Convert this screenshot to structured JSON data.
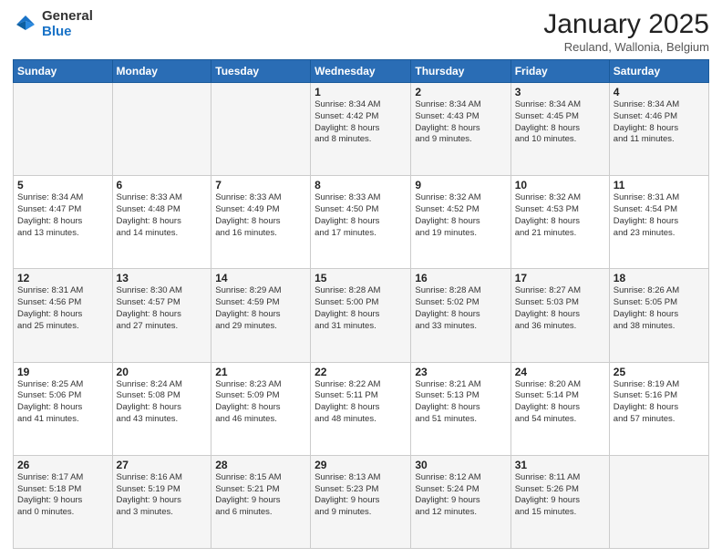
{
  "logo": {
    "general": "General",
    "blue": "Blue"
  },
  "title": "January 2025",
  "subtitle": "Reuland, Wallonia, Belgium",
  "weekdays": [
    "Sunday",
    "Monday",
    "Tuesday",
    "Wednesday",
    "Thursday",
    "Friday",
    "Saturday"
  ],
  "weeks": [
    [
      {
        "day": "",
        "info": ""
      },
      {
        "day": "",
        "info": ""
      },
      {
        "day": "",
        "info": ""
      },
      {
        "day": "1",
        "info": "Sunrise: 8:34 AM\nSunset: 4:42 PM\nDaylight: 8 hours\nand 8 minutes."
      },
      {
        "day": "2",
        "info": "Sunrise: 8:34 AM\nSunset: 4:43 PM\nDaylight: 8 hours\nand 9 minutes."
      },
      {
        "day": "3",
        "info": "Sunrise: 8:34 AM\nSunset: 4:45 PM\nDaylight: 8 hours\nand 10 minutes."
      },
      {
        "day": "4",
        "info": "Sunrise: 8:34 AM\nSunset: 4:46 PM\nDaylight: 8 hours\nand 11 minutes."
      }
    ],
    [
      {
        "day": "5",
        "info": "Sunrise: 8:34 AM\nSunset: 4:47 PM\nDaylight: 8 hours\nand 13 minutes."
      },
      {
        "day": "6",
        "info": "Sunrise: 8:33 AM\nSunset: 4:48 PM\nDaylight: 8 hours\nand 14 minutes."
      },
      {
        "day": "7",
        "info": "Sunrise: 8:33 AM\nSunset: 4:49 PM\nDaylight: 8 hours\nand 16 minutes."
      },
      {
        "day": "8",
        "info": "Sunrise: 8:33 AM\nSunset: 4:50 PM\nDaylight: 8 hours\nand 17 minutes."
      },
      {
        "day": "9",
        "info": "Sunrise: 8:32 AM\nSunset: 4:52 PM\nDaylight: 8 hours\nand 19 minutes."
      },
      {
        "day": "10",
        "info": "Sunrise: 8:32 AM\nSunset: 4:53 PM\nDaylight: 8 hours\nand 21 minutes."
      },
      {
        "day": "11",
        "info": "Sunrise: 8:31 AM\nSunset: 4:54 PM\nDaylight: 8 hours\nand 23 minutes."
      }
    ],
    [
      {
        "day": "12",
        "info": "Sunrise: 8:31 AM\nSunset: 4:56 PM\nDaylight: 8 hours\nand 25 minutes."
      },
      {
        "day": "13",
        "info": "Sunrise: 8:30 AM\nSunset: 4:57 PM\nDaylight: 8 hours\nand 27 minutes."
      },
      {
        "day": "14",
        "info": "Sunrise: 8:29 AM\nSunset: 4:59 PM\nDaylight: 8 hours\nand 29 minutes."
      },
      {
        "day": "15",
        "info": "Sunrise: 8:28 AM\nSunset: 5:00 PM\nDaylight: 8 hours\nand 31 minutes."
      },
      {
        "day": "16",
        "info": "Sunrise: 8:28 AM\nSunset: 5:02 PM\nDaylight: 8 hours\nand 33 minutes."
      },
      {
        "day": "17",
        "info": "Sunrise: 8:27 AM\nSunset: 5:03 PM\nDaylight: 8 hours\nand 36 minutes."
      },
      {
        "day": "18",
        "info": "Sunrise: 8:26 AM\nSunset: 5:05 PM\nDaylight: 8 hours\nand 38 minutes."
      }
    ],
    [
      {
        "day": "19",
        "info": "Sunrise: 8:25 AM\nSunset: 5:06 PM\nDaylight: 8 hours\nand 41 minutes."
      },
      {
        "day": "20",
        "info": "Sunrise: 8:24 AM\nSunset: 5:08 PM\nDaylight: 8 hours\nand 43 minutes."
      },
      {
        "day": "21",
        "info": "Sunrise: 8:23 AM\nSunset: 5:09 PM\nDaylight: 8 hours\nand 46 minutes."
      },
      {
        "day": "22",
        "info": "Sunrise: 8:22 AM\nSunset: 5:11 PM\nDaylight: 8 hours\nand 48 minutes."
      },
      {
        "day": "23",
        "info": "Sunrise: 8:21 AM\nSunset: 5:13 PM\nDaylight: 8 hours\nand 51 minutes."
      },
      {
        "day": "24",
        "info": "Sunrise: 8:20 AM\nSunset: 5:14 PM\nDaylight: 8 hours\nand 54 minutes."
      },
      {
        "day": "25",
        "info": "Sunrise: 8:19 AM\nSunset: 5:16 PM\nDaylight: 8 hours\nand 57 minutes."
      }
    ],
    [
      {
        "day": "26",
        "info": "Sunrise: 8:17 AM\nSunset: 5:18 PM\nDaylight: 9 hours\nand 0 minutes."
      },
      {
        "day": "27",
        "info": "Sunrise: 8:16 AM\nSunset: 5:19 PM\nDaylight: 9 hours\nand 3 minutes."
      },
      {
        "day": "28",
        "info": "Sunrise: 8:15 AM\nSunset: 5:21 PM\nDaylight: 9 hours\nand 6 minutes."
      },
      {
        "day": "29",
        "info": "Sunrise: 8:13 AM\nSunset: 5:23 PM\nDaylight: 9 hours\nand 9 minutes."
      },
      {
        "day": "30",
        "info": "Sunrise: 8:12 AM\nSunset: 5:24 PM\nDaylight: 9 hours\nand 12 minutes."
      },
      {
        "day": "31",
        "info": "Sunrise: 8:11 AM\nSunset: 5:26 PM\nDaylight: 9 hours\nand 15 minutes."
      },
      {
        "day": "",
        "info": ""
      }
    ]
  ]
}
